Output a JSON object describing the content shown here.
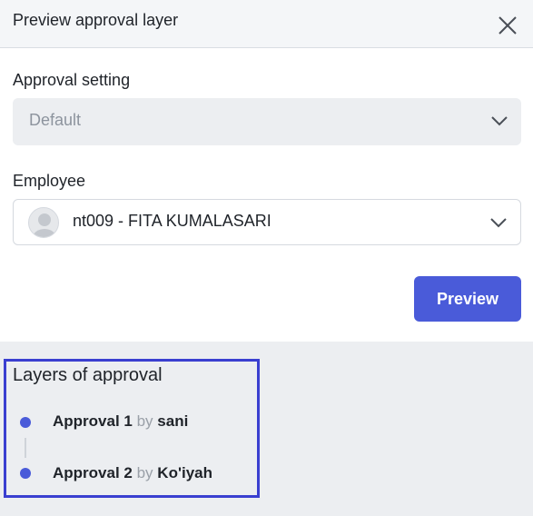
{
  "header": {
    "title": "Preview approval layer",
    "close_icon": "close-icon"
  },
  "approval_setting": {
    "label": "Approval setting",
    "value": "Default",
    "disabled": true
  },
  "employee": {
    "label": "Employee",
    "value": "nt009 - FITA KUMALASARI",
    "avatar_icon": "user-avatar-icon"
  },
  "actions": {
    "preview_label": "Preview"
  },
  "layers": {
    "title": "Layers of approval",
    "steps": [
      {
        "name": "Approval 1",
        "by": "by",
        "user": "sani"
      },
      {
        "name": "Approval 2",
        "by": "by",
        "user": "Ko'iyah"
      }
    ]
  },
  "colors": {
    "accent": "#4a5bd9",
    "highlight_border": "#3a3fd0",
    "section_bg": "#eceef1"
  }
}
